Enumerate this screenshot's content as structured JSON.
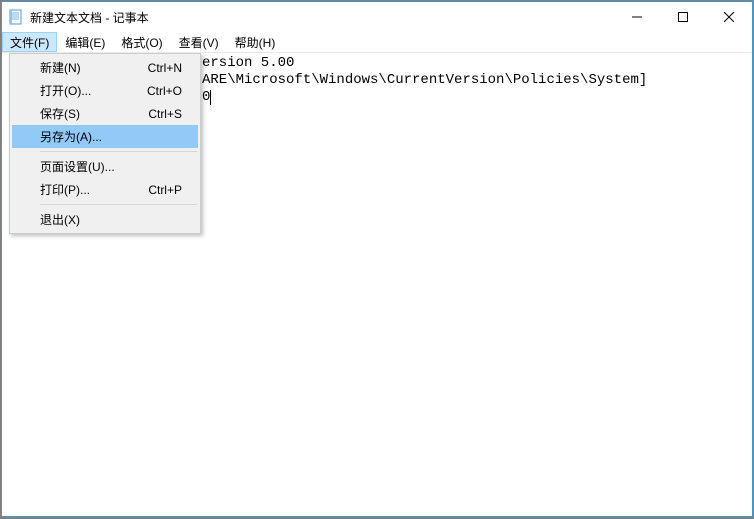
{
  "titlebar": {
    "title": "新建文本文档 - 记事本"
  },
  "menubar": {
    "file": "文件(F)",
    "edit": "编辑(E)",
    "format": "格式(O)",
    "view": "查看(V)",
    "help": "帮助(H)"
  },
  "file_menu": {
    "new_label": "新建(N)",
    "new_accel": "Ctrl+N",
    "open_label": "打开(O)...",
    "open_accel": "Ctrl+O",
    "save_label": "保存(S)",
    "save_accel": "Ctrl+S",
    "saveas_label": "另存为(A)...",
    "pagesetup_label": "页面设置(U)...",
    "print_label": "打印(P)...",
    "print_accel": "Ctrl+P",
    "exit_label": "退出(X)"
  },
  "editor": {
    "visible_line1_fragment": "ersion 5.00",
    "visible_line2_fragment": "ARE\\Microsoft\\Windows\\CurrentVersion\\Policies\\System]",
    "visible_line3_fragment": "0"
  }
}
